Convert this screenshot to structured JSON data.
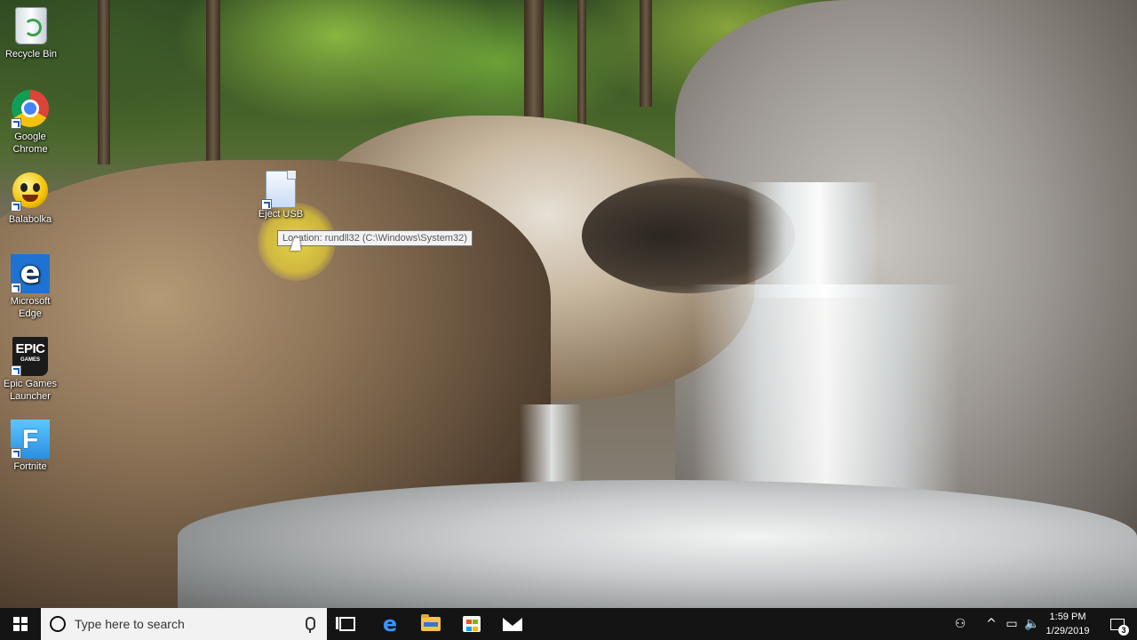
{
  "desktop": {
    "icons": [
      {
        "label": "Recycle Bin",
        "icon": "recycle-bin-icon"
      },
      {
        "label": "Google Chrome",
        "icon": "chrome-icon"
      },
      {
        "label": "Balabolka",
        "icon": "balabolka-icon"
      },
      {
        "label": "Microsoft Edge",
        "icon": "edge-icon"
      },
      {
        "label": "Epic Games Launcher",
        "icon": "epic-games-icon",
        "tile_text": "EPIC",
        "tile_subtext": "GAMES"
      },
      {
        "label": "Fortnite",
        "icon": "fortnite-icon",
        "tile_text": "F"
      }
    ],
    "hovered_icon": {
      "label": "Eject USB",
      "icon": "document-shortcut-icon"
    },
    "tooltip": "Location: rundll32 (C:\\Windows\\System32)"
  },
  "taskbar": {
    "search_placeholder": "Type here to search",
    "pinned": [
      "task-view",
      "microsoft-edge",
      "file-explorer",
      "microsoft-store",
      "mail"
    ],
    "tray": {
      "time": "1:59 PM",
      "date": "1/29/2019",
      "notification_count": "3"
    }
  },
  "colors": {
    "taskbar_bg": "#141414",
    "search_bg": "#f2f2f2",
    "edge_blue": "#1e73d2"
  }
}
